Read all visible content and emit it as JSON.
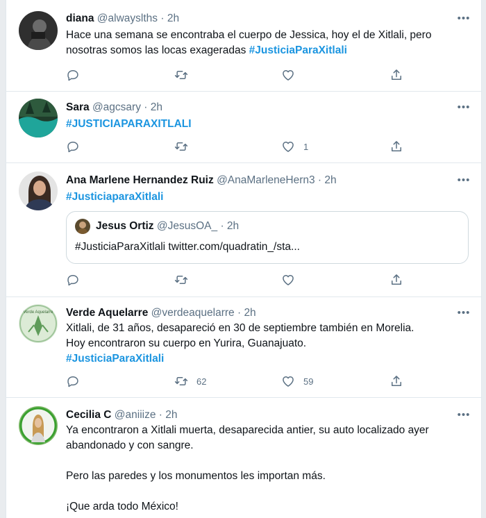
{
  "tweets": [
    {
      "name": "diana",
      "handle": "@alwayslths",
      "dot": "·",
      "time": "2h",
      "text1": "Hace una semana se encontraba el cuerpo de Jessica, hoy el de Xitlali, pero",
      "text2": "nosotras somos las locas exageradas ",
      "hashtag": "#JusticiaParaXitlali",
      "retweets": "",
      "likes": ""
    },
    {
      "name": "Sara",
      "handle": "@agcsary",
      "dot": "·",
      "time": "2h",
      "hashtag": "#JUSTICIAPARAXITLALI",
      "retweets": "",
      "likes": "1"
    },
    {
      "name": "Ana Marlene Hernandez Ruiz",
      "handle": "@AnaMarleneHern3",
      "dot": "·",
      "time": "2h",
      "hashtag": "#JusticiaparaXitlali",
      "quote": {
        "name": "Jesus Ortiz",
        "handle": "@JesusOA_",
        "dot": "·",
        "time": "2h",
        "text": "#JusticiaParaXitlali twitter.com/quadratin_/sta..."
      },
      "retweets": "",
      "likes": ""
    },
    {
      "name": "Verde Aquelarre",
      "handle": "@verdeaquelarre",
      "dot": "·",
      "time": "2h",
      "text1": "Xitlali, de 31 años, desapareció en 30 de septiembre también en Morelia.",
      "text2": "Hoy encontraron su cuerpo en Yurira, Guanajuato.",
      "hashtag": "#JusticiaParaXitlali",
      "retweets": "62",
      "likes": "59",
      "avatar_text": "Verde Aquelarre"
    },
    {
      "name": "Cecilia C",
      "handle": "@aniiize",
      "dot": "·",
      "time": "2h",
      "text1": "Ya encontraron a Xitlali muerta, desaparecida antier, su auto localizado ayer",
      "text2": "abandonado y con sangre.",
      "text3": "Pero las paredes y los monumentos les importan más.",
      "text4": "¡Que arda todo México!"
    }
  ],
  "more_glyph": "•••",
  "colors": {
    "hashtag": "#1b95e0",
    "secondary": "#5b7083",
    "border": "#e1e8ed"
  },
  "icons": [
    "reply-icon",
    "retweet-icon",
    "like-icon",
    "share-icon",
    "more-icon"
  ]
}
